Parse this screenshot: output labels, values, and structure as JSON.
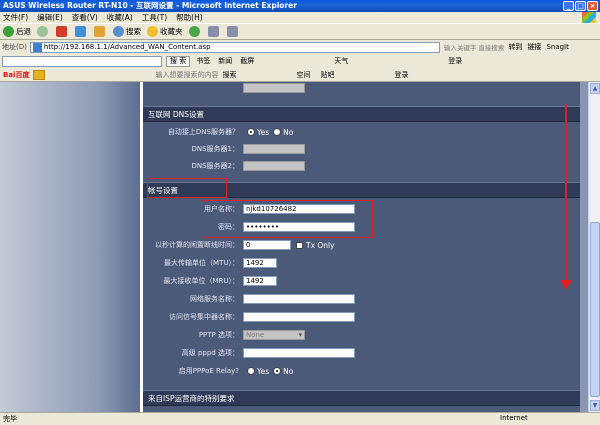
{
  "window": {
    "title": "ASUS Wireless Router RT-N10 - 互联网设置 - Microsoft Internet Explorer",
    "min": "_",
    "max": "□",
    "close": "×"
  },
  "menu": [
    "文件(F)",
    "编辑(E)",
    "查看(V)",
    "收藏(A)",
    "工具(T)",
    "帮助(H)"
  ],
  "toolbar": {
    "back": "后退",
    "search": "搜索",
    "favorites": "收藏夹"
  },
  "address": {
    "label": "地址(D)",
    "url": "http://192.168.1.1/Advanced_WAN_Content.asp",
    "hint": "输入关键字 直接搜索",
    "go": "转到",
    "links": "链接",
    "snagit": "SnagIt"
  },
  "searchbar": {
    "button": "搜 索",
    "items": [
      "书签",
      "新闻",
      "截屏",
      "天气"
    ],
    "login": "登录"
  },
  "baidubar": {
    "brand": "Bai百度",
    "hint": "输入想要搜索的内容",
    "search": "搜索",
    "items": [
      "空间",
      "贴吧"
    ],
    "login": "登录"
  },
  "dns": {
    "title": "互联网 DNS设置",
    "auto_label": "自动接上DNS服务器？",
    "yes": "Yes",
    "no": "No",
    "auto_value": "yes",
    "dns1_label": "DNS服务器1：",
    "dns2_label": "DNS服务器2："
  },
  "account": {
    "title": "帐号设置",
    "username_label": "用户名称：",
    "username_value": "njkd10726482",
    "password_label": "密码：",
    "password_value": "••••••••",
    "idle_label": "以秒计算的闲置断线时间：",
    "idle_value": "0",
    "tx_only": "Tx Only",
    "mtu_label": "最大传输单位（MTU）：",
    "mtu_value": "1492",
    "mru_label": "最大接收单位（MRU）：",
    "mru_value": "1492",
    "service_label": "网络服务名称：",
    "ac_label": "访问信号集中器名称：",
    "pptp_label": "PPTP 选项：",
    "pptp_value": "None",
    "pppd_label": "高级 pppd 选项：",
    "relay_label": "启用PPPoE Relay?",
    "relay_value": "no"
  },
  "isp": {
    "title": "来自ISP运营商的特别要求"
  },
  "status": {
    "left": "完毕",
    "zone": "Internet"
  }
}
